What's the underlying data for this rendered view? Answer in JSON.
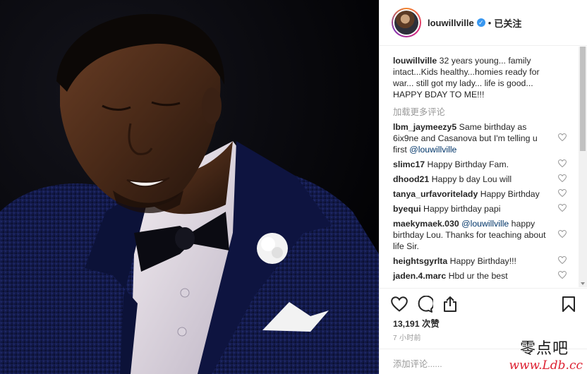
{
  "post": {
    "username": "louwillville",
    "follow_state": "已关注",
    "separator": "•",
    "verified_icon": "verified-badge-icon",
    "caption_username": "louwillville",
    "caption_text": " 32 years young... family intact...Kids healthy...homies ready for war... still got my lady... life is good... HAPPY BDAY TO ME!!!",
    "load_more": "加载更多评论",
    "likes": "13,191 次赞",
    "time": "7 小时前",
    "add_comment_placeholder": "添加评论......"
  },
  "comments": [
    {
      "user": "lbm_jaymeezy5",
      "text": " Same birthday as 6ix9ne and Casanova but I'm telling u first ",
      "mention": "@louwillville"
    },
    {
      "user": "slimc17",
      "text": " Happy Birthday Fam."
    },
    {
      "user": "dhood21",
      "text": " Happy b day Lou will"
    },
    {
      "user": "tanya_urfavoritelady",
      "text": " Happy Birthday"
    },
    {
      "user": "byequi",
      "text": " Happy birthday papi"
    },
    {
      "user": "maekymaek.030",
      "text": " happy birthday Lou. Thanks for teaching about life Sir.",
      "mention": "@louwillville",
      "mention_first": true
    },
    {
      "user": "heightsgyrlta",
      "text": " Happy Birthday!!!"
    },
    {
      "user": "jaden.4.marc",
      "text": " Hbd ur the best"
    }
  ],
  "icons": {
    "like": "heart-icon",
    "comment": "comment-bubble-icon",
    "share": "share-icon",
    "save": "bookmark-icon"
  },
  "watermark": {
    "top": "零点吧",
    "bottom": "www.Ldb.cc"
  },
  "colors": {
    "verified": "#3897f0",
    "mention": "#003569",
    "muted": "#999999",
    "text": "#262626",
    "suit": "#141c4a",
    "background": "#05050a"
  }
}
